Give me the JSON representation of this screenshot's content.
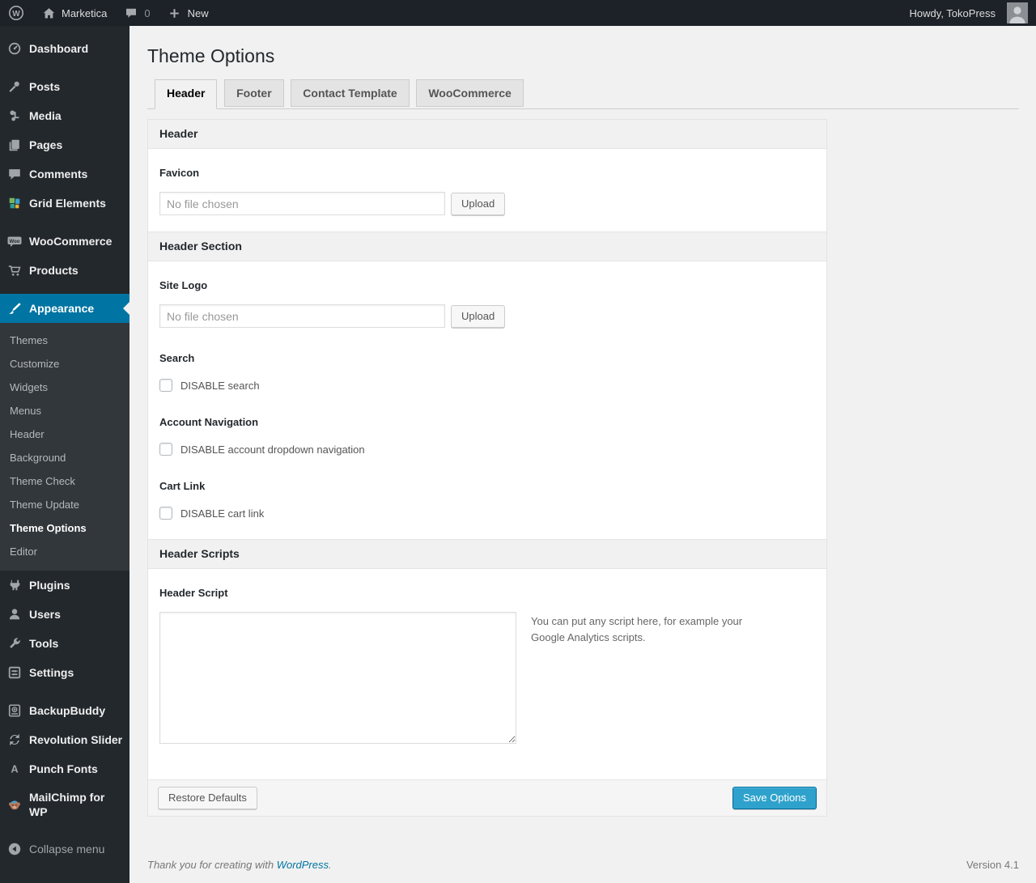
{
  "colors": {
    "accent": "#0074a2",
    "primary_button": "#2ea2cc",
    "admin_bar_bg": "#1d2228",
    "menu_bg": "#23282d",
    "submenu_bg": "#32373c",
    "content_bg": "#f1f1f1",
    "link": "#0074a2"
  },
  "admin_bar": {
    "site_name": "Marketica",
    "comments_count": "0",
    "new_label": "New",
    "howdy": "Howdy, TokoPress"
  },
  "sidebar": {
    "items": [
      {
        "label": "Dashboard",
        "icon": "dashboard-icon"
      },
      {
        "label": "Posts",
        "icon": "pin-icon"
      },
      {
        "label": "Media",
        "icon": "media-icon"
      },
      {
        "label": "Pages",
        "icon": "pages-icon"
      },
      {
        "label": "Comments",
        "icon": "comments-icon"
      },
      {
        "label": "Grid Elements",
        "icon": "grid-elements-icon"
      },
      {
        "label": "WooCommerce",
        "icon": "woocommerce-icon"
      },
      {
        "label": "Products",
        "icon": "cart-icon"
      },
      {
        "label": "Appearance",
        "icon": "brush-icon",
        "active": true
      },
      {
        "label": "Plugins",
        "icon": "plugin-icon"
      },
      {
        "label": "Users",
        "icon": "users-icon"
      },
      {
        "label": "Tools",
        "icon": "wrench-icon"
      },
      {
        "label": "Settings",
        "icon": "settings-icon"
      },
      {
        "label": "BackupBuddy",
        "icon": "backup-icon"
      },
      {
        "label": "Revolution Slider",
        "icon": "revolution-icon"
      },
      {
        "label": "Punch Fonts",
        "icon": "punch-fonts-icon"
      },
      {
        "label": "MailChimp for WP",
        "icon": "mailchimp-icon"
      },
      {
        "label": "Collapse menu",
        "icon": "collapse-icon"
      }
    ],
    "appearance_submenu": [
      {
        "label": "Themes"
      },
      {
        "label": "Customize"
      },
      {
        "label": "Widgets"
      },
      {
        "label": "Menus"
      },
      {
        "label": "Header"
      },
      {
        "label": "Background"
      },
      {
        "label": "Theme Check"
      },
      {
        "label": "Theme Update"
      },
      {
        "label": "Theme Options",
        "current": true
      },
      {
        "label": "Editor"
      }
    ]
  },
  "main": {
    "page_title": "Theme Options",
    "tabs": [
      {
        "label": "Header",
        "active": true
      },
      {
        "label": "Footer",
        "active": false
      },
      {
        "label": "Contact Template",
        "active": false
      },
      {
        "label": "WooCommerce",
        "active": false
      }
    ],
    "panel": {
      "bars": [
        "Header",
        "Header Section",
        "Header Scripts"
      ],
      "favicon": {
        "label": "Favicon",
        "value": "",
        "placeholder": "No file chosen",
        "upload_label": "Upload"
      },
      "site_logo": {
        "label": "Site Logo",
        "value": "",
        "placeholder": "No file chosen",
        "upload_label": "Upload"
      },
      "search": {
        "label": "Search",
        "checkbox_label": "DISABLE search",
        "checked": false
      },
      "account_navigation": {
        "label": "Account Navigation",
        "checkbox_label": "DISABLE account dropdown navigation",
        "checked": false
      },
      "cart_link": {
        "label": "Cart Link",
        "checkbox_label": "DISABLE cart link",
        "checked": false
      },
      "header_script": {
        "label": "Header Script",
        "value": "",
        "hint": "You can put any script here, for example your Google Analytics scripts."
      },
      "restore_defaults_label": "Restore Defaults",
      "save_options_label": "Save Options"
    }
  },
  "page_footer": {
    "thanks_prefix": "Thank you for creating with ",
    "wordpress_link": "WordPress",
    "thanks_suffix": ".",
    "version": "Version 4.1"
  }
}
